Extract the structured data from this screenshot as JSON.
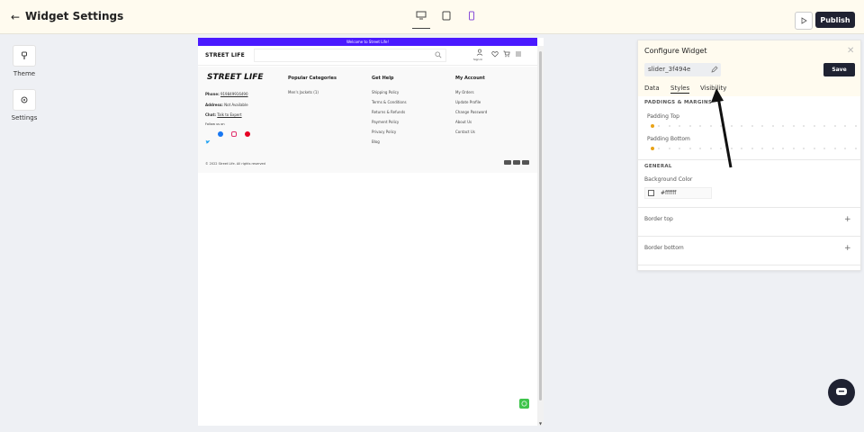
{
  "header": {
    "title": "Widget Settings",
    "publish_label": "Publish"
  },
  "sidebar": {
    "items": [
      {
        "label": "Theme"
      },
      {
        "label": "Settings"
      }
    ]
  },
  "preview": {
    "promo_text": "Welcome to Street Life!",
    "logo": "STREET LIFE",
    "signin_label": "Sign In",
    "footer": {
      "logo": "STREET LIFE",
      "phone_label": "Phone:",
      "phone_value": "919849916490",
      "address_label": "Address:",
      "address_value": "Not Available",
      "chat_label": "Chat:",
      "chat_value": "Talk to Expert",
      "follow_label": "Follow us on",
      "columns": [
        {
          "heading": "Popular Categories",
          "items": [
            "Men's Jackets (1)"
          ]
        },
        {
          "heading": "Get Help",
          "items": [
            "Shipping Policy",
            "Terms & Conditions",
            "Returns & Refunds",
            "Payment Policy",
            "Privacy Policy",
            "Blog"
          ]
        },
        {
          "heading": "My Account",
          "items": [
            "My Orders",
            "Update Profile",
            "Change Password",
            "About Us",
            "Contact Us"
          ]
        }
      ],
      "copyright": "© 2022 Street Life. All rights reserved"
    }
  },
  "panel": {
    "title": "Configure Widget",
    "widget_id": "slider_3f494e",
    "save_label": "Save",
    "tabs": [
      "Data",
      "Styles",
      "Visibility"
    ],
    "active_tab": "Styles",
    "sections": {
      "paddings_heading": "PADDINGS & MARGINS",
      "padding_top_label": "Padding Top",
      "padding_top_value": 0,
      "padding_bottom_label": "Padding Bottom",
      "padding_bottom_value": 0,
      "general_heading": "GENERAL",
      "bg_color_label": "Background Color",
      "bg_color_value": "#ffffff",
      "border_top_label": "Border top",
      "border_bottom_label": "Border bottom"
    }
  },
  "colors": {
    "accent_dark": "#1f2232",
    "promo_bar": "#4a19ff",
    "slider_knob": "#e8a317",
    "whatsapp": "#3ec44b"
  }
}
